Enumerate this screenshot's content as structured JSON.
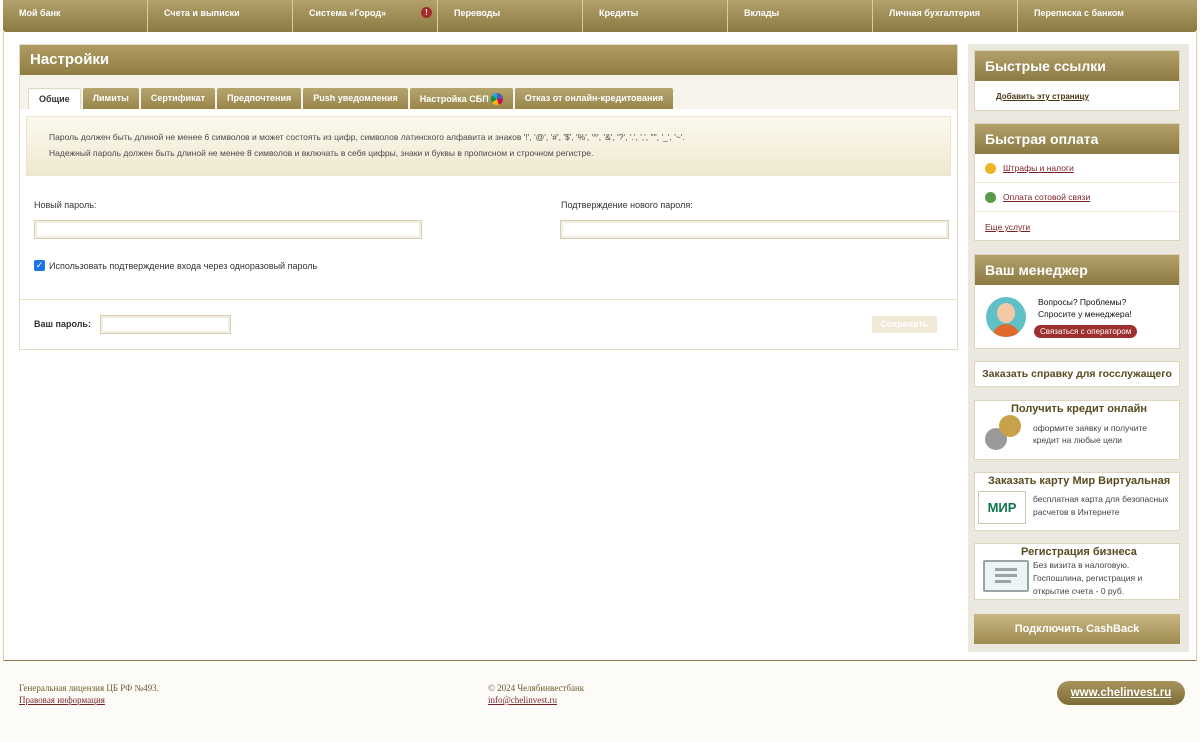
{
  "nav": {
    "items": [
      {
        "label": "Мой банк"
      },
      {
        "label": "Счета и выписки"
      },
      {
        "label": "Система «Город»"
      },
      {
        "label": "Переводы"
      },
      {
        "label": "Кредиты"
      },
      {
        "label": "Вклады"
      },
      {
        "label": "Личная бухгалтерия"
      },
      {
        "label": "Переписка с банком"
      }
    ],
    "alert_mark": "!"
  },
  "settings": {
    "title": "Настройки",
    "tabs": [
      {
        "label": "Общие",
        "active": true
      },
      {
        "label": "Лимиты"
      },
      {
        "label": "Сертификат"
      },
      {
        "label": "Предпочтения"
      },
      {
        "label": "Push уведомления"
      },
      {
        "label": "Настройка СБП"
      },
      {
        "label": "Отказ от онлайн-кредитования"
      }
    ],
    "notice_line1": "Пароль должен быть длиной не менее 6 символов и может состоять из цифр, символов латинского алфавита и знаков '!', '@', '#', '$', '%', '^', '&', '?', '.', ',', '\"', '_', '~'.",
    "notice_line2": "Надежный пароль должен быть длиной не менее 8 символов и включать в себя цифры, знаки и буквы в прописном и строчном регистре.",
    "new_password_label": "Новый пароль:",
    "confirm_password_label": "Подтверждение нового пароля:",
    "otp_checkbox_label": "Использовать подтверждение входа через одноразовый пароль",
    "otp_checked": true,
    "your_password_label": "Ваш пароль:",
    "save_label": "Сохранить"
  },
  "sidebar": {
    "quick_links": {
      "title": "Быстрые ссылки",
      "add_page": "Добавить эту страницу"
    },
    "quick_pay": {
      "title": "Быстрая оплата",
      "items": [
        {
          "label": "Штрафы и налоги",
          "icon": "coin-icon"
        },
        {
          "label": "Оплата сотовой связи",
          "icon": "phone-icon"
        },
        {
          "label": "Еще услуги"
        }
      ]
    },
    "manager": {
      "title": "Ваш менеджер",
      "line1": "Вопросы? Проблемы?",
      "line2": "Спросите у менеджера!",
      "contact_button": "Связаться с оператором"
    },
    "cert_button": "Заказать справку для госслужащего",
    "credit": {
      "title": "Получить кредит онлайн",
      "line1": "оформите заявку и получите",
      "line2": "кредит на любые цели"
    },
    "mir": {
      "title": "Заказать карту Мир Виртуальная",
      "logo": "МИР",
      "line1": "бесплатная карта для безопасных",
      "line2": "расчетов в Интернете"
    },
    "business": {
      "title": "Регистрация бизнеса",
      "line1": "Без визита в налоговую.",
      "line2": "Госпошлина, регистрация и",
      "line3": "открытие счета - 0 руб."
    },
    "cashback_button": "Подключить CashBack"
  },
  "footer": {
    "license": "Генеральная лицензия ЦБ РФ №493.",
    "legal_link": "Правовая информация",
    "copyright": "© 2024 Челябинвестбанк",
    "email": "info@chelinvest.ru",
    "site": "www.chelinvest.ru"
  },
  "colors": {
    "gold": "#8f7d45",
    "link_red": "#7a1f24",
    "alert": "#a52a2a"
  }
}
